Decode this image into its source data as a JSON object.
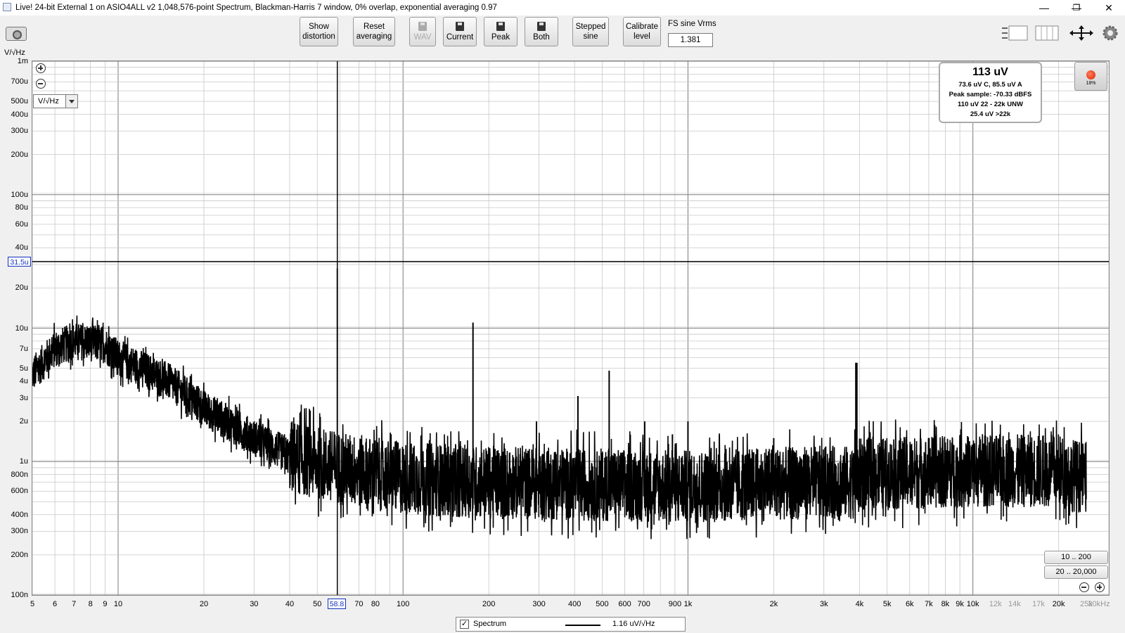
{
  "window": {
    "title": "Live! 24-bit External 1 on ASIO4ALL v2 1,048,576-point Spectrum, Blackman-Harris 7 window, 0% overlap, exponential averaging 0.97",
    "minimize": "—",
    "maximize": "❐",
    "close": "✕"
  },
  "toolbar": {
    "show_distortion": [
      "Show",
      "distortion"
    ],
    "reset_averaging": [
      "Reset",
      "averaging"
    ],
    "wav": "WAV",
    "current": "Current",
    "peak": "Peak",
    "both": "Both",
    "stepped_sine": [
      "Stepped",
      "sine"
    ],
    "calibrate_level": [
      "Calibrate",
      "level"
    ],
    "fs_label": "FS sine Vrms",
    "fs_value": "1.381"
  },
  "plot": {
    "y_unit": "V/√Hz",
    "unit_selector": "V/√Hz",
    "cursor_y_label": "31.5u",
    "cursor_x_label": "58.8",
    "y_ticks": [
      "1m",
      "700u",
      "500u",
      "400u",
      "300u",
      "200u",
      "100u",
      "80u",
      "60u",
      "40u",
      "20u",
      "10u",
      "7u",
      "5u",
      "4u",
      "3u",
      "2u",
      "1u",
      "800n",
      "600n",
      "400n",
      "300n",
      "200n",
      "100n"
    ],
    "x_ticks": [
      "5",
      "6",
      "7",
      "8",
      "9",
      "10",
      "20",
      "30",
      "40",
      "50",
      "70",
      "80",
      "100",
      "200",
      "300",
      "400",
      "500",
      "600",
      "700",
      "900",
      "1k",
      "2k",
      "3k",
      "4k",
      "5k",
      "6k",
      "7k",
      "8k",
      "9k",
      "10k",
      "12k",
      "14k",
      "17k",
      "20k",
      "25k",
      "30kHz"
    ],
    "range_button_1": "10 .. 200",
    "range_button_2": "20 .. 20,000"
  },
  "info": {
    "headline": "113 uV",
    "line1": "73.6 uV C, 85.5 uV A",
    "line2": "Peak sample: -70.33 dBFS",
    "line3": "110 uV 22 - 22k UNW",
    "line4": "25.4 uV >22k"
  },
  "record": {
    "percent": "18%"
  },
  "legend": {
    "checkbox": "✓",
    "name": "Spectrum",
    "value": "1.16 uV/√Hz"
  },
  "colors": {
    "trace": "#000000",
    "grid": "#c8c8c8",
    "cursor_label": "#1030c0",
    "record_dot": "#e02000"
  },
  "chart_data": {
    "type": "line",
    "xscale": "log",
    "yscale": "log",
    "xlim": [
      5,
      30000
    ],
    "ylim": [
      1e-07,
      0.001
    ],
    "xlabel": "",
    "ylabel": "V/√Hz",
    "cursor": {
      "x": 58.8,
      "y": 3.15e-05
    },
    "noise_floor": [
      [
        5,
        4.5e-06
      ],
      [
        6,
        7e-06
      ],
      [
        7,
        8e-06
      ],
      [
        9,
        7.5e-06
      ],
      [
        10,
        6e-06
      ],
      [
        12,
        5e-06
      ],
      [
        15,
        4e-06
      ],
      [
        20,
        2.5e-06
      ],
      [
        30,
        1.5e-06
      ],
      [
        40,
        1.1e-06
      ],
      [
        58.8,
        9e-07
      ],
      [
        100,
        7.5e-07
      ],
      [
        200,
        7e-07
      ],
      [
        1000,
        6.5e-07
      ],
      [
        3000,
        7e-07
      ],
      [
        3900,
        7e-07
      ],
      [
        4000,
        8e-07
      ],
      [
        10000,
        8.5e-07
      ],
      [
        20000,
        8.5e-07
      ],
      [
        25000,
        7.5e-07
      ]
    ],
    "spurs": [
      {
        "freq": 58.8,
        "value": 2.8e-05
      },
      {
        "freq": 176,
        "value": 1.1e-05
      },
      {
        "freq": 294,
        "value": 2e-06
      },
      {
        "freq": 411,
        "value": 3.1e-06
      },
      {
        "freq": 529,
        "value": 4.8e-06
      },
      {
        "freq": 705,
        "value": 2e-06
      },
      {
        "freq": 882,
        "value": 1.6e-06
      },
      {
        "freq": 1000,
        "value": 2e-06
      },
      {
        "freq": 2000,
        "value": 1.5e-06
      },
      {
        "freq": 3900,
        "value": 5.5e-06
      }
    ]
  }
}
